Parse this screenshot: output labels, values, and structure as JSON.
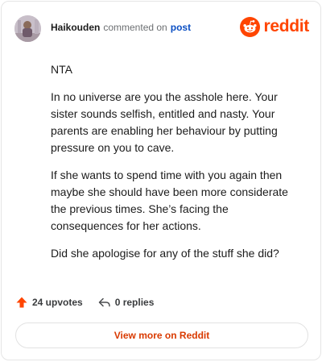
{
  "header": {
    "author": "Haikouden",
    "commented_text": "commented on",
    "post_link": "post",
    "brand": "reddit",
    "icons": {
      "avatar": "user-avatar",
      "brand_logo": "reddit-snoo-icon"
    }
  },
  "comment": {
    "paragraphs": [
      "NTA",
      "In no universe are you the asshole here. Your sister sounds selfish, entitled and nasty. Your parents are enabling her behaviour by putting pressure on you to cave.",
      "If she wants to spend time with you again then maybe she should have been more considerate the previous times. She’s facing the consequences for her actions.",
      "Did she apologise for any of the stuff she did?"
    ]
  },
  "footer": {
    "upvotes": "24 upvotes",
    "replies": "0 replies",
    "icons": {
      "upvote": "upvote-arrow-icon",
      "reply": "reply-arrow-icon"
    }
  },
  "cta": {
    "label": "View more on Reddit"
  },
  "colors": {
    "brand": "#ff4500",
    "link": "#0b4fc3",
    "cta_text": "#d93a00",
    "border": "#e5e5e5"
  }
}
